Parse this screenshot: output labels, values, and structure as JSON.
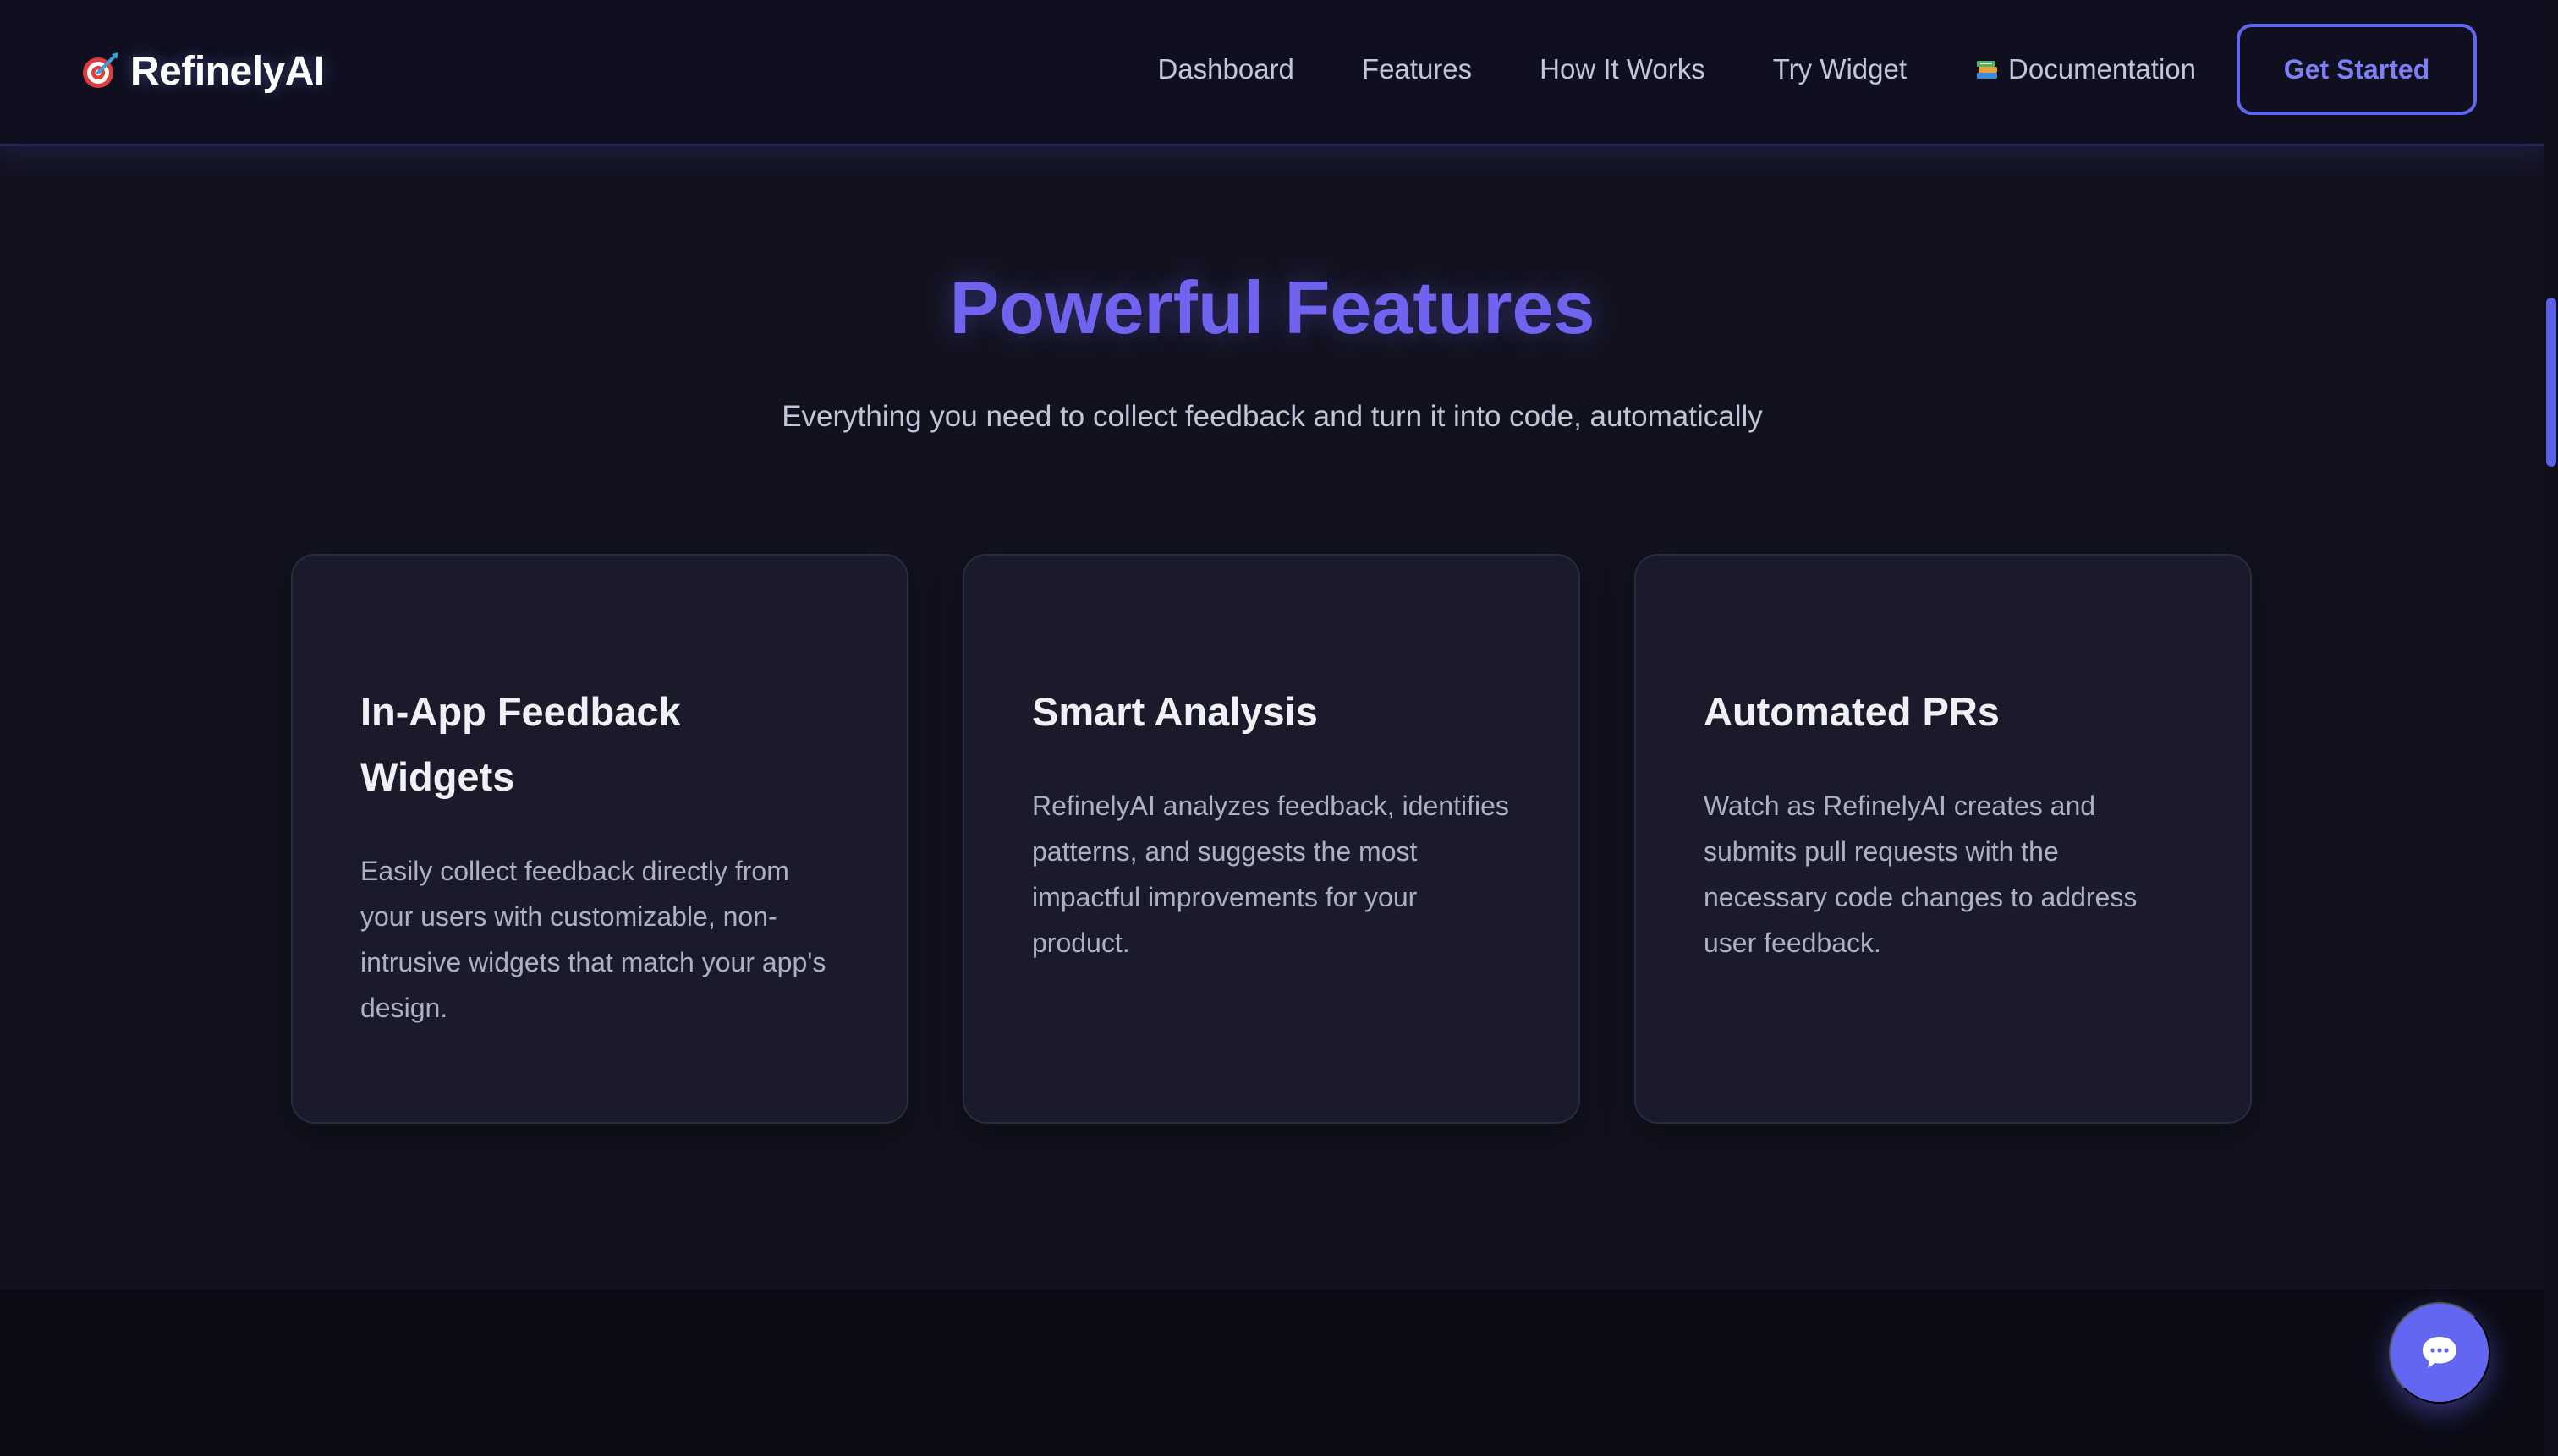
{
  "header": {
    "brand_icon": "target-dart-icon",
    "brand_name": "RefinelyAI",
    "nav": [
      {
        "label": "Dashboard"
      },
      {
        "label": "Features"
      },
      {
        "label": "How It Works"
      },
      {
        "label": "Try Widget"
      },
      {
        "label": "Documentation",
        "icon": "books-icon"
      }
    ],
    "cta_label": "Get Started"
  },
  "features": {
    "title": "Powerful Features",
    "subtitle": "Everything you need to collect feedback and turn it into code, automatically",
    "cards": [
      {
        "title": "In-App Feedback Widgets",
        "description": "Easily collect feedback directly from your users with customizable, non-intrusive widgets that match your app's design."
      },
      {
        "title": "Smart Analysis",
        "description": "RefinelyAI analyzes feedback, identifies patterns, and suggests the most impactful improvements for your product."
      },
      {
        "title": "Automated PRs",
        "description": "Watch as RefinelyAI creates and submits pull requests with the necessary code changes to address user feedback."
      }
    ]
  },
  "chat_button_icon": "chat-bubble-icon",
  "colors": {
    "accent": "#6366f1",
    "title": "#6f63ef",
    "background": "#12121f",
    "card": "#1a1a2b"
  }
}
